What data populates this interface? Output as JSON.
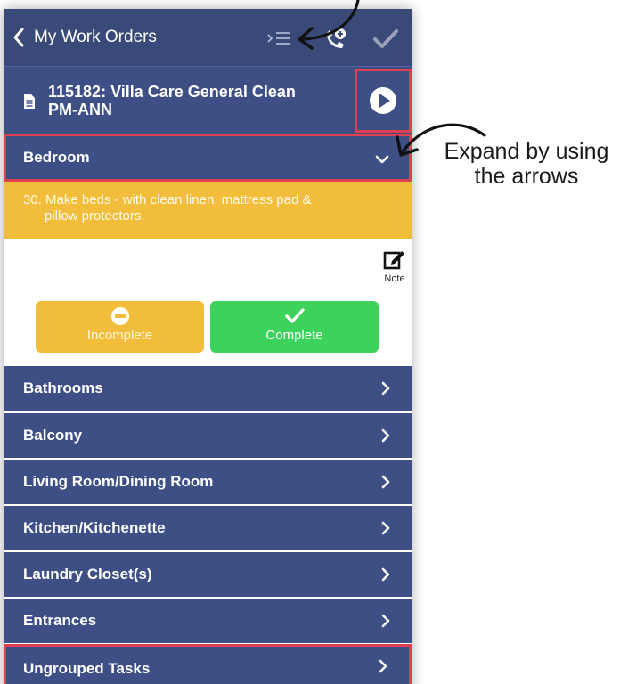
{
  "nav": {
    "back_label": "My Work Orders",
    "icons": [
      "chevron-left-icon",
      "list-indent-icon",
      "phone-add-icon",
      "checkmark-icon"
    ]
  },
  "work_order": {
    "title_line1": "115182: Villa Care General Clean",
    "title_line2": "PM-ANN",
    "play_icon": "play-circle-icon"
  },
  "current_section": {
    "label": "Bedroom",
    "state": "expanded"
  },
  "task": {
    "line1": "30.  Make beds - with clean linen, mattress pad &",
    "line2": "pillow protectors.",
    "note_label": "Note",
    "incomplete_label": "Incomplete",
    "complete_label": "Complete"
  },
  "sections": [
    {
      "label": "Bathrooms"
    },
    {
      "label": "Balcony"
    },
    {
      "label": "Living Room/Dining Room"
    },
    {
      "label": "Kitchen/Kitchenette"
    },
    {
      "label": "Laundry Closet(s)"
    },
    {
      "label": "Entrances"
    },
    {
      "label": "Ungrouped Tasks"
    }
  ],
  "annotation": {
    "line1": "Expand by using",
    "line2": "the arrows"
  },
  "colors": {
    "nav_bg": "#3a4a78",
    "section_bg": "#3e4f85",
    "task_yellow": "#f2bd3b",
    "complete_green": "#3dd25c",
    "highlight_red": "#e04050"
  }
}
